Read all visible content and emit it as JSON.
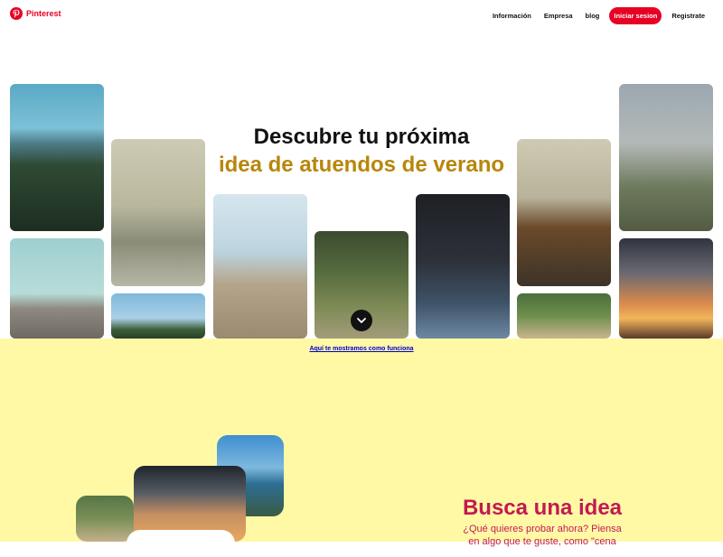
{
  "header": {
    "brand": "Pinterest",
    "nav": {
      "info": "Información",
      "company": "Empresa",
      "blog": "blog",
      "login": "Iniciar sesion",
      "signup": "Registrate"
    }
  },
  "hero": {
    "title": "Descubre tu próxima",
    "subtitle": "idea de atuendos de verano"
  },
  "how_link": "Aquí te mostramos como funciona",
  "section": {
    "title": "Busca una idea",
    "description": "¿Qué quieres probar ahora? Piensa en algo que te guste, como \"cena"
  },
  "colors": {
    "brand": "#e60023",
    "hero_accent": "#b8860b",
    "section_bg": "#fff9a6",
    "section_text": "#c31952"
  }
}
